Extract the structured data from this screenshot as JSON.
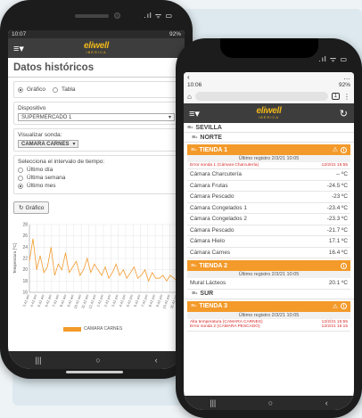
{
  "left_phone": {
    "status_time": "10:07",
    "status_right": "92%",
    "app_title": "Datos históricos",
    "view_options": {
      "grafico": "Gráfico",
      "tabla": "Tabla",
      "selected": "grafico"
    },
    "device_label": "Dispositivo",
    "device_value": "SUPERMERCADO 1",
    "probe_label": "Visualizar sonda:",
    "probe_value": "CAMARA CARNES",
    "interval_label": "Selecciona el intervalo de tiempo:",
    "intervals": [
      "Último día",
      "Última semana",
      "Último mes"
    ],
    "selected_interval": "Último mes",
    "button_label": "Gráfico"
  },
  "chart_data": {
    "type": "line",
    "ylabel": "Temperatura [ºC]",
    "ylim": [
      16,
      28
    ],
    "yticks": [
      16,
      18,
      20,
      22,
      24,
      26,
      28
    ],
    "x_ticks": [
      "3.41 am",
      "4.41 am",
      "5.41 am",
      "6.41 am",
      "7.41 am",
      "8.41 am",
      "9.41 am",
      "10.41 am",
      "11.41 am",
      "12.41 pm",
      "1.41 pm",
      "2.41 pm",
      "3.41 pm",
      "4.41 pm",
      "5.41 pm",
      "6.41 pm",
      "7.41 pm",
      "8.41 pm",
      "9.41 pm",
      "10.41 pm",
      "11.41 pm"
    ],
    "series": [
      {
        "name": "CAMARA CARNES",
        "color": "#f39a2a",
        "values": [
          21.5,
          25.5,
          20.0,
          22.5,
          19.5,
          20.5,
          24.0,
          19.0,
          21.0,
          20.0,
          23.0,
          19.5,
          20.5,
          21.5,
          19.0,
          20.0,
          22.0,
          19.5,
          21.0,
          20.0,
          19.0,
          20.5,
          18.5,
          19.5,
          21.0,
          19.0,
          20.0,
          18.5,
          19.5,
          20.5,
          18.5,
          19.0,
          20.0,
          18.0,
          19.5,
          18.5,
          18.5,
          19.0,
          18.0,
          19.0,
          18.5,
          18.0
        ]
      }
    ]
  },
  "right_phone": {
    "status_time": "10:06",
    "status_right": "92%",
    "browser_tabs": "1",
    "regions": [
      {
        "name": "SEVILLA"
      },
      {
        "name": "NORTE"
      }
    ],
    "tienda1": {
      "name": "TIENDA 1",
      "last_reg": "Último registro 2/3/21 10:05",
      "error_text": "Error sonda 1 (Cámara Charcutería)",
      "error_date": "12/2/21 15:55",
      "probes": [
        {
          "name": "Cámara Charcutería",
          "value": "-- ºC"
        },
        {
          "name": "Cámara Frutas",
          "value": "-24.5 ºC"
        },
        {
          "name": "Cámara Pescado",
          "value": "-23 ºC"
        },
        {
          "name": "Cámara Congelados 1",
          "value": "-23.4 ºC"
        },
        {
          "name": "Cámara Congelados 2",
          "value": "-23.3 ºC"
        },
        {
          "name": "Cámara Pescado",
          "value": "-21.7 ºC"
        },
        {
          "name": "Cámara Hielo",
          "value": "17.1 ºC"
        },
        {
          "name": "Cámara Carnes",
          "value": "16.4 ºC"
        }
      ]
    },
    "tienda2": {
      "name": "TIENDA 2",
      "last_reg": "Último registro 2/3/21 10:05",
      "probes": [
        {
          "name": "Mural Lácteos",
          "value": "20.1 ºC"
        }
      ]
    },
    "region_sur": "SUR",
    "tienda3": {
      "name": "TIENDA 3",
      "last_reg": "Último registro 2/3/21 10:05",
      "error1_text": "Alta temperatura (CAMARA CARNES)",
      "error1_date": "12/2/21 15:55",
      "error2_text": "Error sonda 2 (CAMARA PESCADO)",
      "error2_date": "12/2/21 15:15"
    }
  },
  "colors": {
    "accent": "#f39a2a",
    "header": "#3d3d3d",
    "logo": "#f0b81a",
    "error": "#d62a2a"
  }
}
